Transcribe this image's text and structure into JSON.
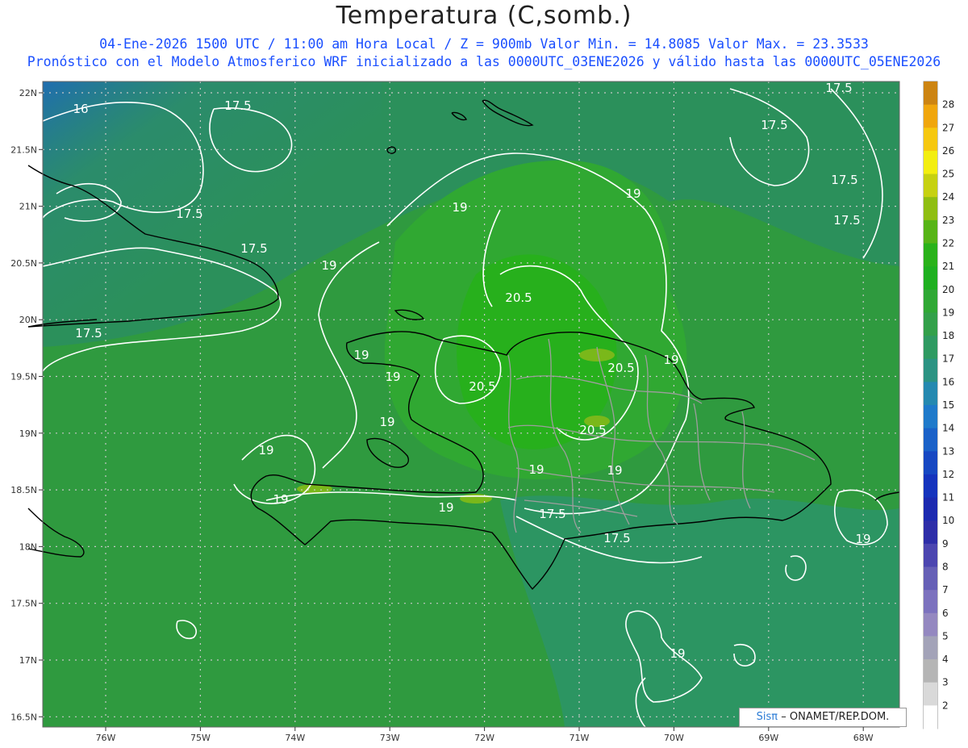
{
  "title": "Temperatura (C,somb.)",
  "subtitle_1": "04-Ene-2026  1500 UTC / 11:00 am Hora Local / Z = 900mb   Valor Min. = 14.8085  Valor Max. = 23.3533",
  "subtitle_2": "Pronóstico con el Modelo Atmosferico WRF inicializado a las 0000UTC_03ENE2026 y válido hasta las  0000UTC_05ENE2026",
  "credit": {
    "brand": "Sisπ",
    "text": "– ONAMET/REP.DOM."
  },
  "colors": {
    "field_base": "#2f9a3f",
    "coast": "#000000",
    "provinces": "#9e9e9e",
    "contours": "#ffffff",
    "grid": "#c8c8c8"
  },
  "chart_data": {
    "type": "heatmap",
    "variable": "Temperatura (C,somb.)",
    "level": "900mb",
    "min_value": 14.8085,
    "max_value": 23.3533,
    "lat_ticks": [
      "22N",
      "21.5N",
      "21N",
      "20.5N",
      "20N",
      "19.5N",
      "19N",
      "18.5N",
      "18N",
      "17.5N",
      "17N",
      "16.5N"
    ],
    "lon_ticks": [
      "76W",
      "75W",
      "74W",
      "73W",
      "72W",
      "71W",
      "70W",
      "69W",
      "68W"
    ],
    "colorbar": {
      "labels": [
        2,
        3,
        4,
        5,
        6,
        7,
        8,
        9,
        10,
        11,
        12,
        13,
        14,
        15,
        16,
        17,
        18,
        19,
        20,
        21,
        22,
        23,
        24,
        25,
        26,
        27,
        28
      ],
      "colors": [
        "#ffffff",
        "#d9d9d9",
        "#b5b5b5",
        "#a3a3b8",
        "#9488c0",
        "#7c72be",
        "#6660b6",
        "#4c46b0",
        "#2e2ea8",
        "#1c2ab0",
        "#1534bd",
        "#1648c2",
        "#1a62c8",
        "#1f7aca",
        "#2589b0",
        "#2c9383",
        "#2f9a62",
        "#33a04a",
        "#30a835",
        "#1fb020",
        "#2ab21a",
        "#57b416",
        "#8fbe12",
        "#c6d111",
        "#f3ee10",
        "#f6c80f",
        "#f0a60c",
        "#cc8412"
      ]
    },
    "contour_labels": [
      "16",
      "17.5",
      "19",
      "20.5"
    ]
  }
}
